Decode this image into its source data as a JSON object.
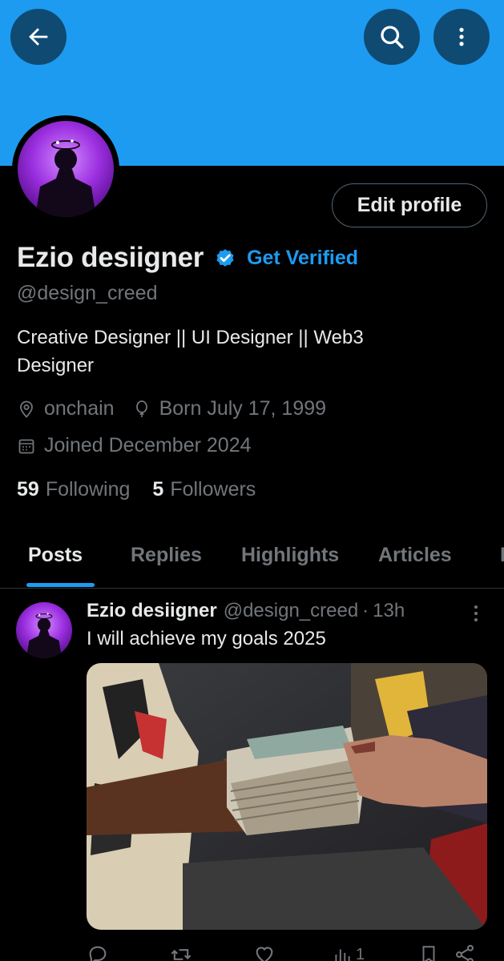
{
  "header": {
    "back_icon": "arrow-left-icon",
    "search_icon": "search-icon",
    "more_icon": "more-vertical-icon",
    "banner_color": "#1d9bf0"
  },
  "profile": {
    "edit_label": "Edit profile",
    "display_name": "Ezio desiigner",
    "get_verified": "Get Verified",
    "handle": "@design_creed",
    "bio": "Creative Designer || UI Designer || Web3 Designer",
    "location": "onchain",
    "birthday": "Born July 17, 1999",
    "joined": "Joined December 2024",
    "following_count": "59",
    "following_label": "Following",
    "followers_count": "5",
    "followers_label": "Followers"
  },
  "tabs": [
    {
      "label": "Posts",
      "active": true
    },
    {
      "label": "Replies",
      "active": false
    },
    {
      "label": "Highlights",
      "active": false
    },
    {
      "label": "Articles",
      "active": false
    }
  ],
  "post": {
    "author": "Ezio desiigner",
    "handle": "@design_creed",
    "separator": "·",
    "time": "13h",
    "text": "I will achieve my goals 2025",
    "views": "1"
  },
  "colors": {
    "accent": "#1d9bf0",
    "muted": "#71767b",
    "text": "#e7e9ea",
    "background": "#000000"
  }
}
